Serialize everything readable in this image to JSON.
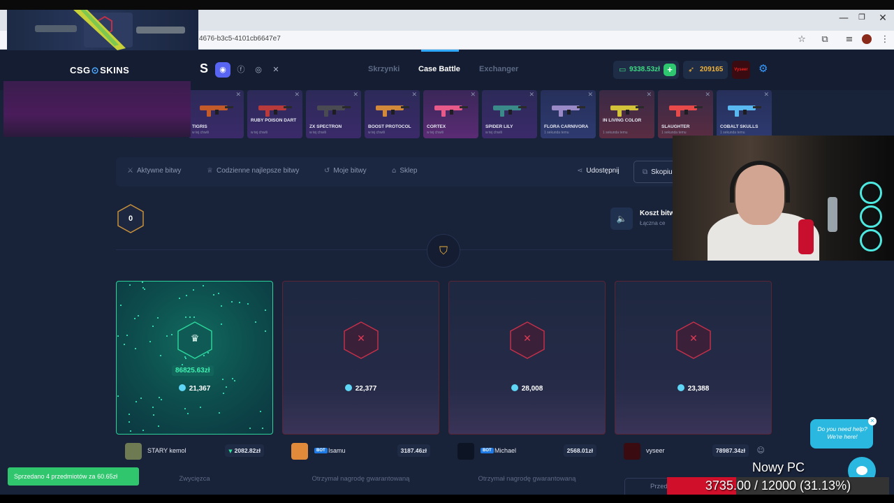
{
  "browser": {
    "url_fragment": "4676-b3c5-4101cb6647e7",
    "win_minimize": "—",
    "win_restore": "❐",
    "win_close": "✕"
  },
  "header": {
    "logo_left": "CSG",
    "logo_mark": "⊙",
    "logo_right": "SKINS",
    "s_letter": "S",
    "nav": [
      "Skrzynki",
      "Case Battle",
      "Exchanger"
    ],
    "active_nav": "Case Battle",
    "balance": "9338.53zł",
    "balance_plus": "+",
    "coins": "209165",
    "avatar_label": "Vyseer"
  },
  "drops": [
    {
      "name": "TIGRIS",
      "sub": "w tej chwili",
      "color": "c-purple",
      "gun": "#c25a2a"
    },
    {
      "name": "RUBY POISON DART",
      "sub": "w tej chwili",
      "color": "c-purple",
      "gun": "#b83a3a"
    },
    {
      "name": "ZX SPECTRON",
      "sub": "w tej chwili",
      "color": "c-purple",
      "gun": "#4a4a52"
    },
    {
      "name": "BOOST PROTOCOL",
      "sub": "w tej chwili",
      "color": "c-purple",
      "gun": "#d28a3a"
    },
    {
      "name": "CORTEX",
      "sub": "w tej chwili",
      "color": "c-pink",
      "gun": "#e85a8a"
    },
    {
      "name": "SPIDER LILY",
      "sub": "w tej chwili",
      "color": "c-purple",
      "gun": "#3a8a8a"
    },
    {
      "name": "FLORA CARNIVORA",
      "sub": "1 sekunda temu",
      "color": "c-blue",
      "gun": "#9a8ac8"
    },
    {
      "name": "IN LIVING COLOR",
      "sub": "1 sekunda temu",
      "color": "c-red",
      "gun": "#d2c23a"
    },
    {
      "name": "SLAUGHTER",
      "sub": "1 sekunda temu",
      "color": "c-red",
      "gun": "#e84a4a"
    },
    {
      "name": "COBALT SKULLS",
      "sub": "1 sekunda temu",
      "color": "c-blue",
      "gun": "#5ab8f0"
    }
  ],
  "drop_close": "✕",
  "battle_nav": {
    "items": [
      {
        "icon": "⚔",
        "label": "Aktywne bitwy"
      },
      {
        "icon": "♕",
        "label": "Codzienne najlepsze bitwy"
      },
      {
        "icon": "↺",
        "label": "Moje bitwy"
      },
      {
        "icon": "⌂",
        "label": "Sklep"
      }
    ],
    "share_icon": "⋖",
    "share": "Udostępnij",
    "copy_icon": "⧉",
    "copy": "Skopiu"
  },
  "round": "0",
  "emblem": "⛉",
  "sound_icon": "🔈",
  "cost_title": "Koszt bitw",
  "cost_sub": "Łączna ce",
  "players": [
    {
      "state": "win",
      "glyph": "♛",
      "amount": "86825.63zł",
      "coins": "21,367",
      "name": "STARY kemol",
      "bot": "",
      "value": "2082.82zł",
      "foot": "Zwycięzca",
      "avatar": "#6d7a52"
    },
    {
      "state": "lose",
      "glyph": "✕",
      "amount": "",
      "coins": "22,377",
      "name": "Isamu",
      "bot": "BOT",
      "value": "3187.46zł",
      "foot": "Otrzymał nagrodę gwarantowaną",
      "avatar": "#e08a3a"
    },
    {
      "state": "lose",
      "glyph": "✕",
      "amount": "",
      "coins": "28,008",
      "name": "Michael",
      "bot": "BOT",
      "value": "2568.01zł",
      "foot": "Otrzymał nagrodę gwarantowaną",
      "avatar": "#0d1424"
    },
    {
      "state": "lose",
      "glyph": "✕",
      "amount": "",
      "coins": "23,388",
      "name": "vyseer",
      "bot": "",
      "value": "78987.34zł",
      "foot": "",
      "avatar": "#3a0b10"
    }
  ],
  "last_player_extra_icon": "☺",
  "last_player_button": "Przed",
  "value_triangle": "▼",
  "toast": "Sprzedano 4 przedmiotów za 60.65zł",
  "help": {
    "line1": "Do you need help?",
    "line2": "We're here!",
    "close": "✕"
  },
  "stream": {
    "label": "Nowy PC",
    "progress_text": "3735.00 / 12000 (31.13%)",
    "progress_fraction": 0.3113
  },
  "colors": {
    "accent": "#2fa8ff",
    "win": "#2bd39a",
    "lose": "#e23a55",
    "balance": "#3ddc84",
    "coins": "#f0b23a"
  }
}
